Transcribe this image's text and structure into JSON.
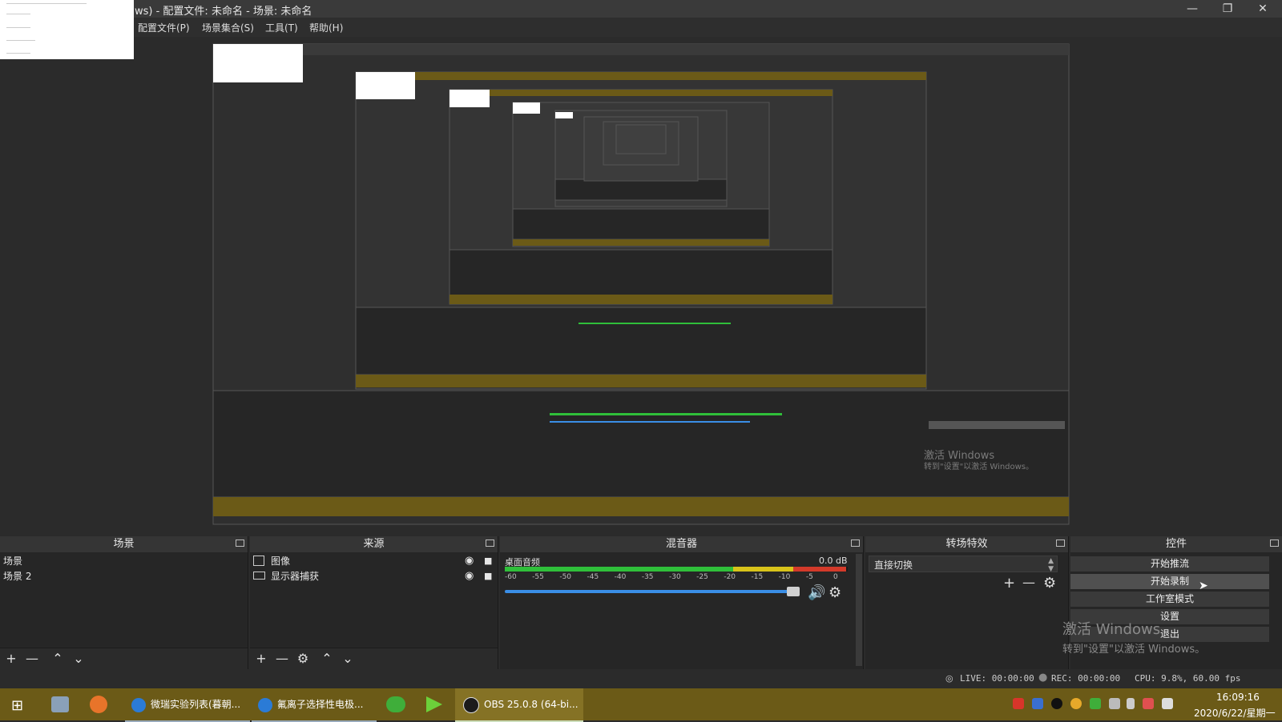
{
  "window": {
    "title": "ws) - 配置文件: 未命名 - 场景: 未命名",
    "min_icon": "minimize-icon",
    "max_icon": "restore-icon",
    "close_icon": "close-icon"
  },
  "menubar": {
    "items": [
      "配置文件(P)",
      "场景集合(S)",
      "工具(T)",
      "帮助(H)"
    ]
  },
  "scenes": {
    "header": "场景",
    "items": [
      "场景",
      "场景 2"
    ]
  },
  "sources": {
    "header": "来源",
    "items": [
      {
        "label": "图像",
        "icon": "image-icon"
      },
      {
        "label": "显示器捕获",
        "icon": "monitor-icon"
      }
    ]
  },
  "mixer": {
    "header": "混音器",
    "channel": "桌面音频",
    "db": "0.0 dB",
    "ticks": [
      "-60",
      "-55",
      "-50",
      "-45",
      "-40",
      "-35",
      "-30",
      "-25",
      "-20",
      "-15",
      "-10",
      "-5",
      "0"
    ],
    "volume_level": 0.97
  },
  "transitions": {
    "header": "转场特效",
    "selected": "直接切换"
  },
  "controls": {
    "header": "控件",
    "buttons": [
      "开始推流",
      "开始录制",
      "工作室模式",
      "设置",
      "退出"
    ]
  },
  "watermark": {
    "line1": "激活 Windows",
    "line2": "转到\"设置\"以激活 Windows。"
  },
  "status": {
    "live": "LIVE: 00:00:00",
    "rec": "REC: 00:00:00",
    "cpu": "CPU: 9.8%, 60.00 fps"
  },
  "taskbar": {
    "apps": [
      {
        "label": "微瑞实验列表(暮朝...",
        "color": "#2b7bd6"
      },
      {
        "label": "氟离子选择性电极...",
        "color": "#2b7bd6"
      },
      {
        "label": "OBS 25.0.8 (64-bi...",
        "color": "#222222"
      }
    ],
    "time": "16:09:16",
    "date": "2020/6/22/星期一"
  },
  "colors": {
    "taskbar": "#6b5a17",
    "titlebar": "#3a3a3a",
    "meter_green": "#2fbf3a",
    "meter_yellow": "#d8c31a",
    "meter_red": "#d33a2a",
    "slider_blue": "#3a8ee6"
  }
}
